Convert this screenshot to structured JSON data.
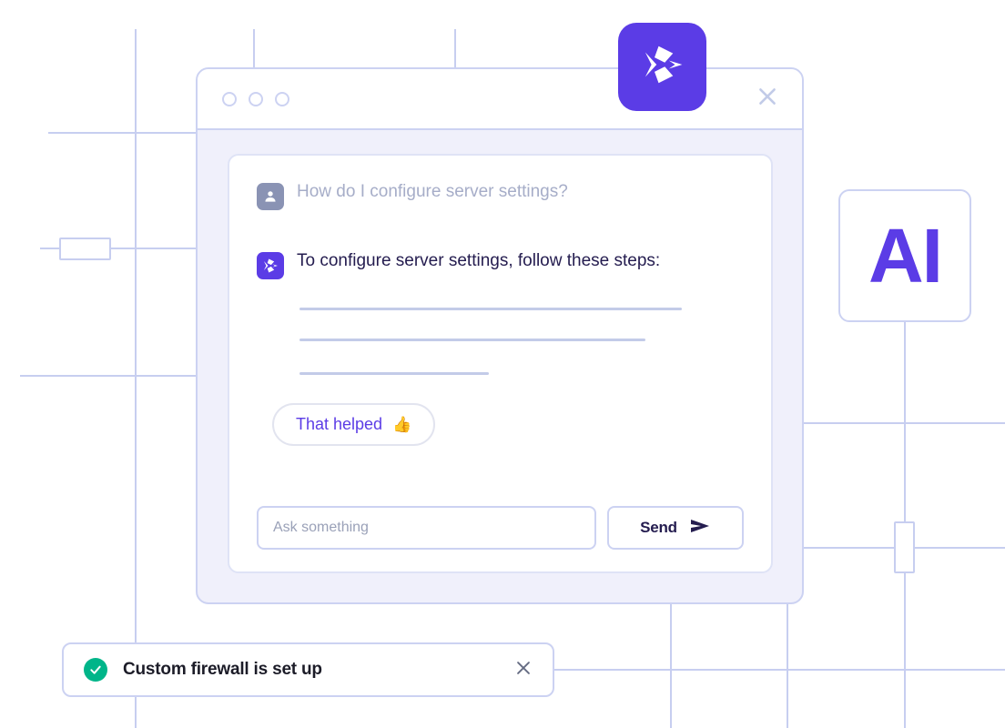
{
  "brand": {
    "accent_purple": "#5b3ce6",
    "grid_line": "#c7cef0",
    "window_body": "#f0f0fb",
    "toast_green": "#00b589",
    "text_dark": "#241c4f",
    "text_muted": "#a6adc8"
  },
  "app_logo": {
    "icon": "brand-arrow-logo-icon"
  },
  "ai_badge": {
    "label": "AI"
  },
  "window": {
    "traffic_dots": [
      "dot-1",
      "dot-2",
      "dot-3"
    ],
    "close_icon": "close-icon"
  },
  "chat": {
    "messages": [
      {
        "role": "user",
        "avatar_icon": "user-avatar-icon",
        "text": "How do I configure server settings?"
      },
      {
        "role": "assistant",
        "avatar_icon": "brand-arrow-logo-icon",
        "text": "To configure server settings, follow these steps:"
      }
    ],
    "skeleton_lines": [
      420,
      380,
      208
    ],
    "feedback_button": {
      "label": "That helped",
      "emoji": "👍"
    }
  },
  "composer": {
    "input_value": "",
    "input_placeholder": "Ask something",
    "send_label": "Send",
    "send_icon": "send-arrow-icon"
  },
  "toast": {
    "status_icon": "check-circle-icon",
    "message": "Custom firewall is set up",
    "close_icon": "close-icon"
  }
}
